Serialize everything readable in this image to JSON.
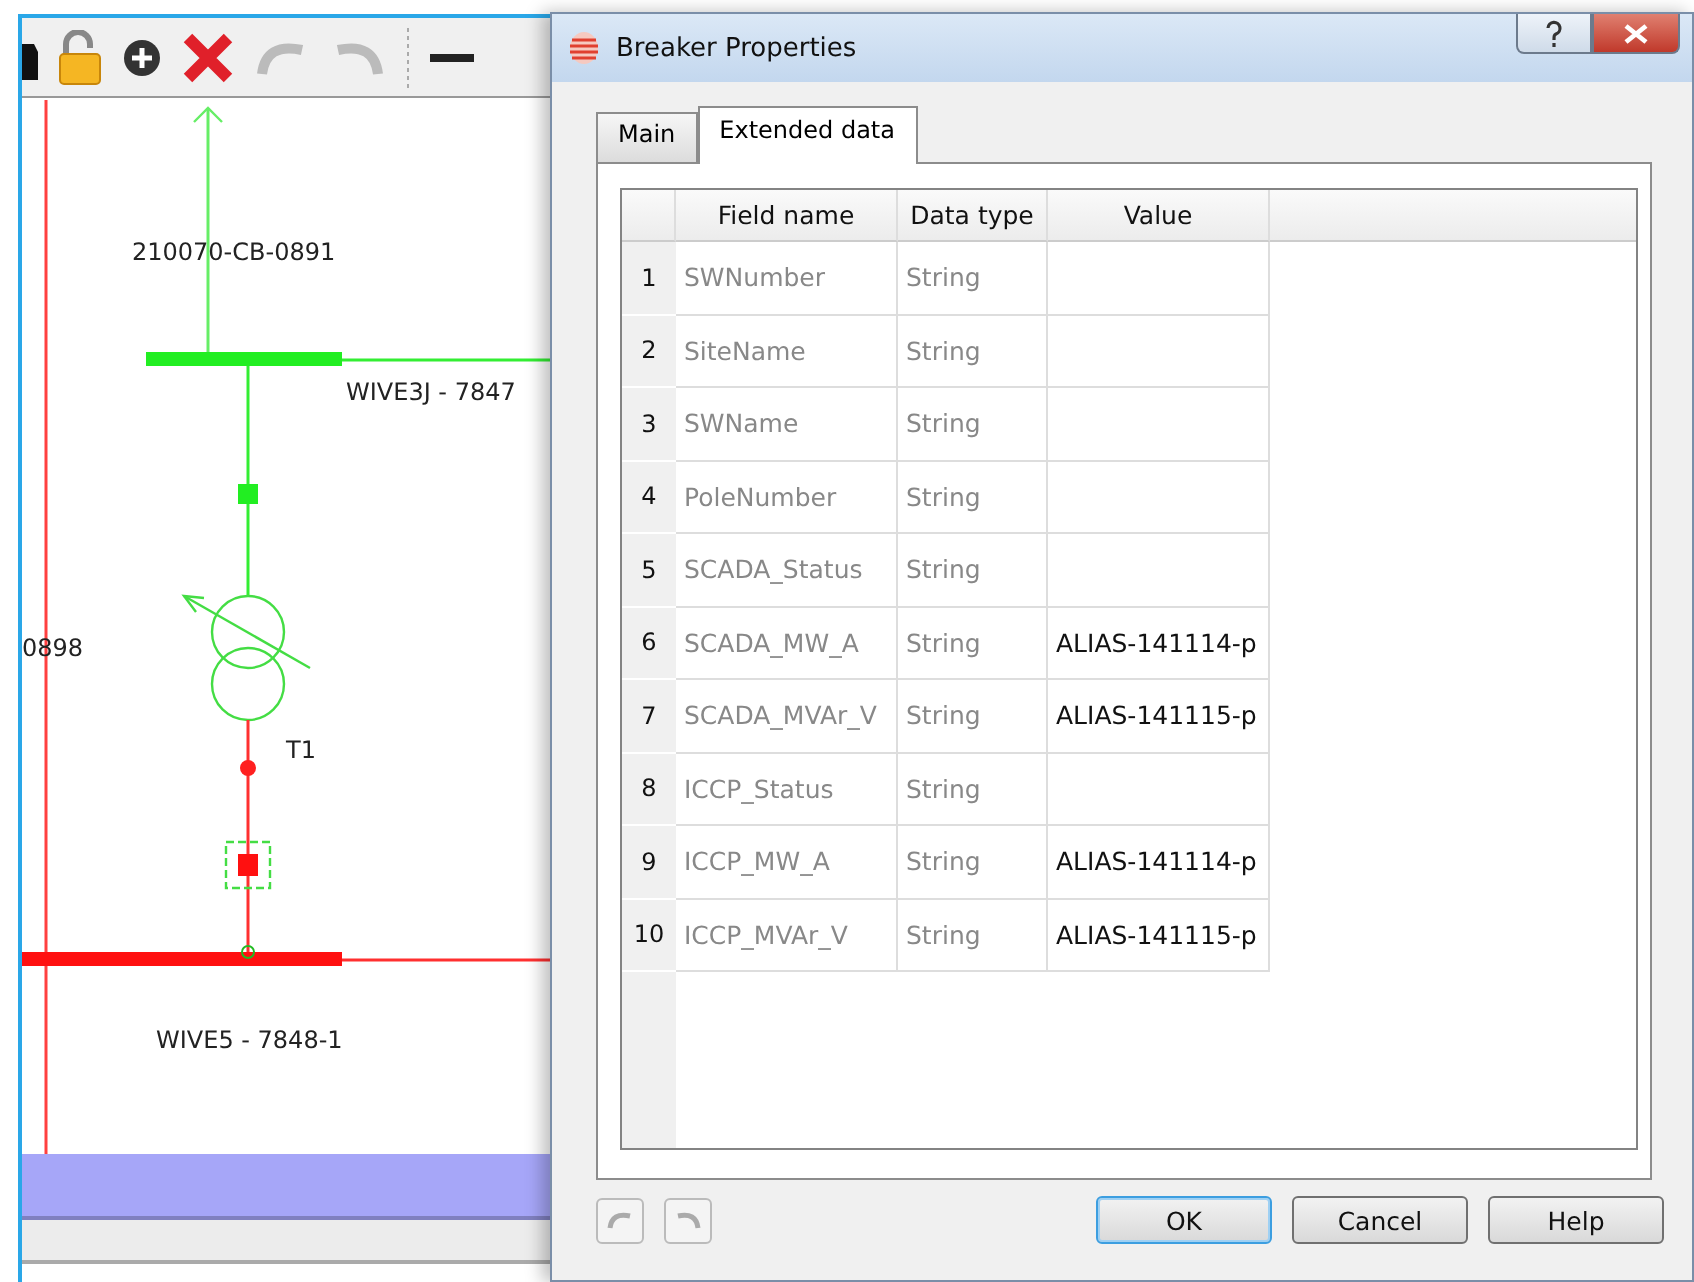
{
  "diagram": {
    "labels": [
      {
        "text": "210070-CB-0891"
      },
      {
        "text": "WIVE3J - 7847"
      },
      {
        "text": "0898"
      },
      {
        "text": "T1"
      },
      {
        "text": "WIVE5 - 7848-1"
      }
    ]
  },
  "dialog": {
    "title": "Breaker Properties",
    "tabs": [
      {
        "label": "Main",
        "selected": false
      },
      {
        "label": "Extended data",
        "selected": true
      }
    ],
    "table": {
      "columns": [
        "Field name",
        "Data type",
        "Value"
      ],
      "rows": [
        {
          "number": "1",
          "field": "SWNumber",
          "type": "String"
        },
        {
          "number": "2",
          "field": "SiteName",
          "type": "String"
        },
        {
          "number": "3",
          "field": "SWName",
          "type": "String"
        },
        {
          "number": "4",
          "field": "PoleNumber",
          "type": "String"
        },
        {
          "number": "5",
          "field": "SCADA_Status",
          "type": "String"
        },
        {
          "number": "6",
          "field": "SCADA_MW_A",
          "type": "String",
          "value": "ALIAS-141114-p"
        },
        {
          "number": "7",
          "field": "SCADA_MVAr_V",
          "type": "String",
          "value": "ALIAS-141115-p"
        },
        {
          "number": "8",
          "field": "ICCP_Status",
          "type": "String"
        },
        {
          "number": "9",
          "field": "ICCP_MW_A",
          "type": "String",
          "value": "ALIAS-141114-p"
        },
        {
          "number": "10",
          "field": "ICCP_MVAr_V",
          "type": "String",
          "value": "ALIAS-141115-p"
        }
      ]
    },
    "buttons": [
      {
        "label": "OK",
        "default": true
      },
      {
        "label": "Cancel",
        "default": false
      },
      {
        "label": "Help",
        "default": false
      }
    ]
  }
}
